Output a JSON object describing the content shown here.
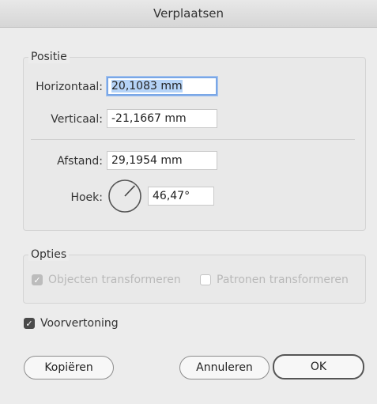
{
  "window": {
    "title": "Verplaatsen"
  },
  "position": {
    "legend": "Positie",
    "horizontal_label": "Horizontaal:",
    "horizontal_value": "20,1083 mm",
    "vertical_label": "Verticaal:",
    "vertical_value": "-21,1667 mm",
    "distance_label": "Afstand:",
    "distance_value": "29,1954 mm",
    "angle_label": "Hoek:",
    "angle_value": "46,47°",
    "angle_degrees": 46.47
  },
  "options": {
    "legend": "Opties",
    "transform_objects": {
      "label": "Objecten transformeren",
      "checked": true,
      "enabled": false
    },
    "transform_patterns": {
      "label": "Patronen transformeren",
      "checked": false,
      "enabled": false
    }
  },
  "preview": {
    "label": "Voorvertoning",
    "checked": true
  },
  "buttons": {
    "copy": "Kopiëren",
    "cancel": "Annuleren",
    "ok": "OK"
  },
  "icons": {
    "check": "checkmark-icon",
    "dial": "angle-dial-icon"
  }
}
